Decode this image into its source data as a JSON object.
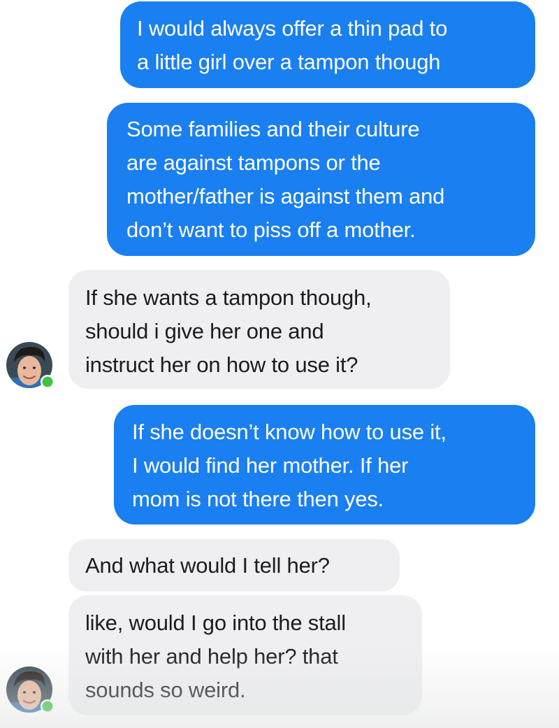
{
  "conversation": {
    "messages": [
      {
        "sender": "me",
        "text": "I would always offer a thin pad to\na little girl over a tampon though"
      },
      {
        "sender": "me",
        "text": "Some families and their culture\nare against tampons or the\nmother/father is against them and\ndon’t want to piss off a mother."
      },
      {
        "sender": "other",
        "text": "If she wants a tampon though,\nshould i give her one and\ninstruct her on how to use it?"
      },
      {
        "sender": "me",
        "text": "If she doesn’t know how to use it,\nI would find her mother. If her\nmom is not there then yes."
      },
      {
        "sender": "other",
        "text": "And what would I tell her?"
      },
      {
        "sender": "other",
        "text": "like, would I go into the stall\nwith her and help her? that\nsounds so weird."
      }
    ]
  },
  "avatars": [
    {
      "icon": "profile-photo-icon",
      "status": "online",
      "status_color": "#3ec43e"
    },
    {
      "icon": "profile-photo-icon",
      "status": "online",
      "status_color": "#3ec43e"
    }
  ],
  "colors": {
    "outgoing_bubble": "#1a7ff0",
    "incoming_bubble": "#efeff2",
    "outgoing_text": "#ffffff",
    "incoming_text": "#1c1c1e"
  }
}
